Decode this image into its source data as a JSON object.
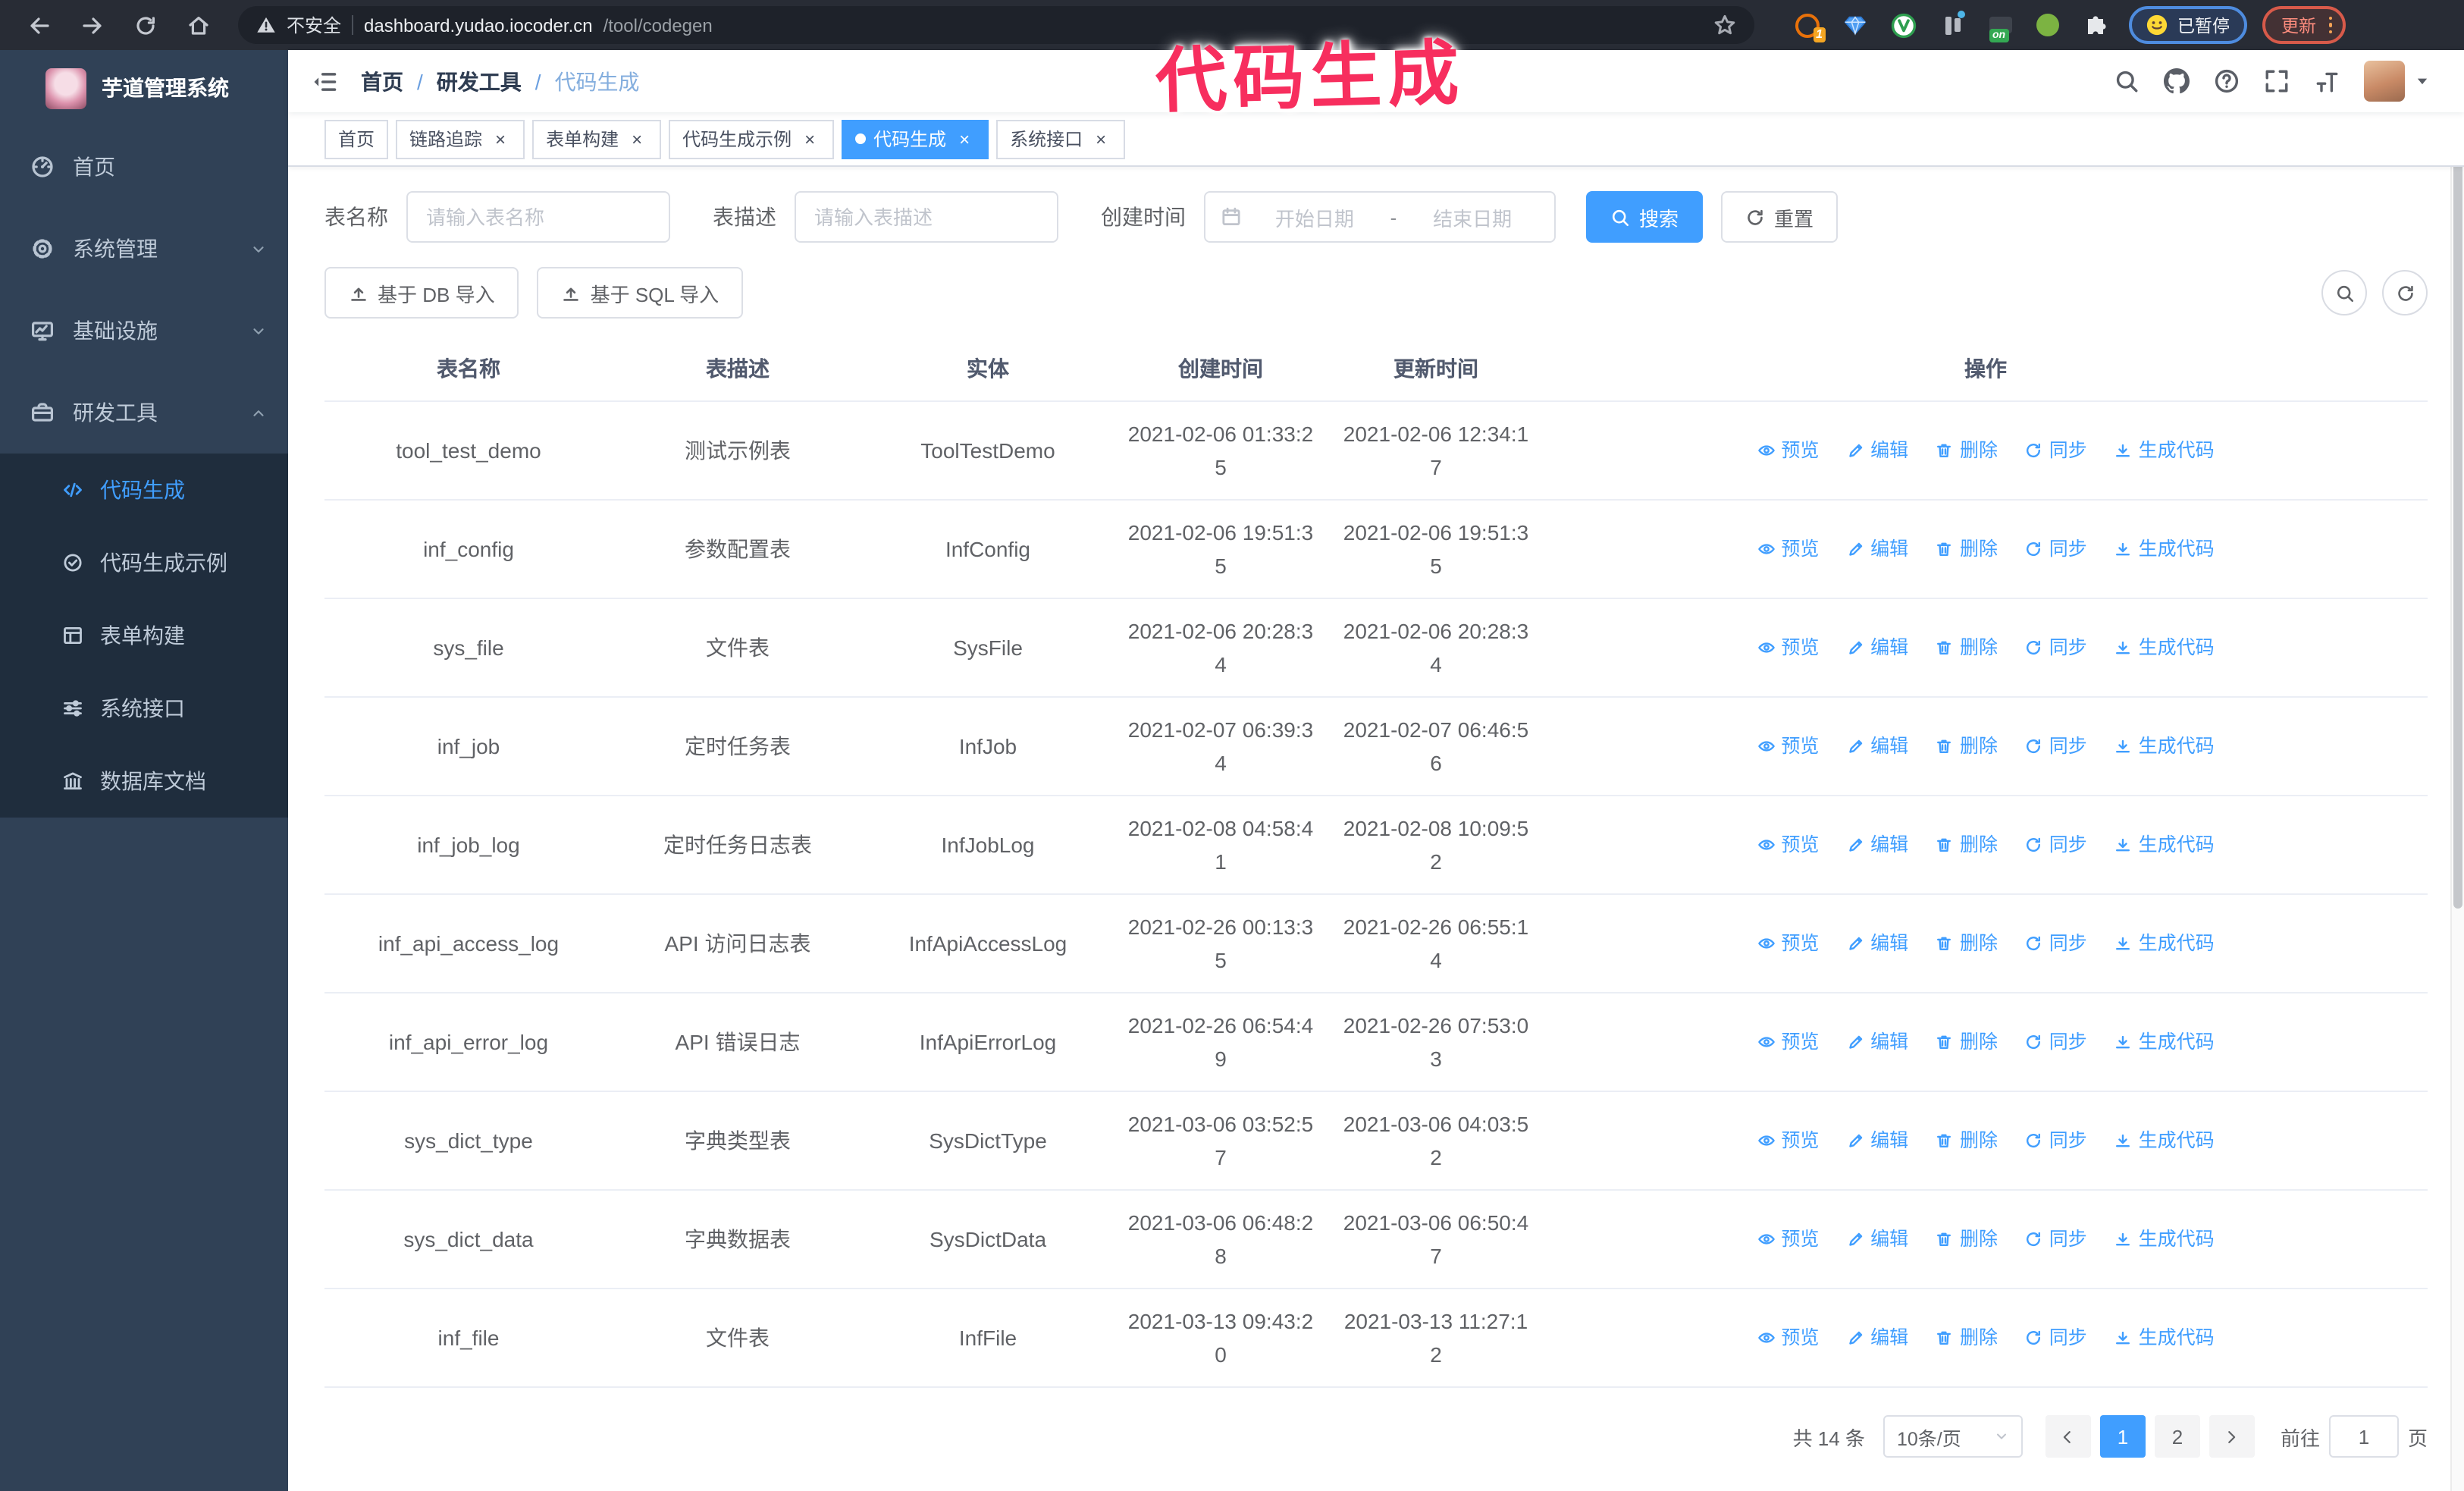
{
  "browser": {
    "security_label": "不安全",
    "url_domain": "dashboard.yudao.iocoder.cn",
    "url_path": "/tool/codegen",
    "extension_badge": "1",
    "extension_on": "on",
    "paused_label": "已暂停",
    "update_label": "更新"
  },
  "annotation": {
    "text": "代码生成",
    "color": "#F72E5E"
  },
  "sidebar": {
    "title": "芋道管理系统",
    "menu": [
      {
        "label": "首页",
        "icon": "dashboard"
      },
      {
        "label": "系统管理",
        "icon": "gear",
        "expandable": true
      },
      {
        "label": "基础设施",
        "icon": "monitor",
        "expandable": true
      },
      {
        "label": "研发工具",
        "icon": "toolbox",
        "expandable": true,
        "expanded": true
      }
    ],
    "submenu": [
      {
        "label": "代码生成",
        "icon": "code",
        "active": true
      },
      {
        "label": "代码生成示例",
        "icon": "badge-check"
      },
      {
        "label": "表单构建",
        "icon": "form"
      },
      {
        "label": "系统接口",
        "icon": "sliders"
      },
      {
        "label": "数据库文档",
        "icon": "database"
      }
    ]
  },
  "navbar": {
    "breadcrumb": [
      "首页",
      "研发工具",
      "代码生成"
    ],
    "separator": "/"
  },
  "tags": [
    {
      "label": "首页"
    },
    {
      "label": "链路追踪",
      "close": "×"
    },
    {
      "label": "表单构建",
      "close": "×"
    },
    {
      "label": "代码生成示例",
      "close": "×"
    },
    {
      "label": "代码生成",
      "close": "×",
      "active": true
    },
    {
      "label": "系统接口",
      "close": "×"
    }
  ],
  "filters": {
    "table_name_label": "表名称",
    "table_name_placeholder": "请输入表名称",
    "table_desc_label": "表描述",
    "table_desc_placeholder": "请输入表描述",
    "create_time_label": "创建时间",
    "date_start_placeholder": "开始日期",
    "date_separator": "-",
    "date_end_placeholder": "结束日期",
    "search_label": "搜索",
    "reset_label": "重置"
  },
  "toolbar": {
    "import_db_label": "基于 DB 导入",
    "import_sql_label": "基于 SQL 导入"
  },
  "table": {
    "columns": [
      "表名称",
      "表描述",
      "实体",
      "创建时间",
      "更新时间",
      "操作"
    ],
    "actions": [
      "预览",
      "编辑",
      "删除",
      "同步",
      "生成代码"
    ],
    "rows": [
      {
        "name": "tool_test_demo",
        "desc": "测试示例表",
        "entity": "ToolTestDemo",
        "created": "2021-02-06 01:33:25",
        "updated": "2021-02-06 12:34:17"
      },
      {
        "name": "inf_config",
        "desc": "参数配置表",
        "entity": "InfConfig",
        "created": "2021-02-06 19:51:35",
        "updated": "2021-02-06 19:51:35"
      },
      {
        "name": "sys_file",
        "desc": "文件表",
        "entity": "SysFile",
        "created": "2021-02-06 20:28:34",
        "updated": "2021-02-06 20:28:34"
      },
      {
        "name": "inf_job",
        "desc": "定时任务表",
        "entity": "InfJob",
        "created": "2021-02-07 06:39:34",
        "updated": "2021-02-07 06:46:56"
      },
      {
        "name": "inf_job_log",
        "desc": "定时任务日志表",
        "entity": "InfJobLog",
        "created": "2021-02-08 04:58:41",
        "updated": "2021-02-08 10:09:52"
      },
      {
        "name": "inf_api_access_log",
        "desc": "API 访问日志表",
        "entity": "InfApiAccessLog",
        "created": "2021-02-26 00:13:35",
        "updated": "2021-02-26 06:55:14"
      },
      {
        "name": "inf_api_error_log",
        "desc": "API 错误日志",
        "entity": "InfApiErrorLog",
        "created": "2021-02-26 06:54:49",
        "updated": "2021-02-26 07:53:03"
      },
      {
        "name": "sys_dict_type",
        "desc": "字典类型表",
        "entity": "SysDictType",
        "created": "2021-03-06 03:52:57",
        "updated": "2021-03-06 04:03:52"
      },
      {
        "name": "sys_dict_data",
        "desc": "字典数据表",
        "entity": "SysDictData",
        "created": "2021-03-06 06:48:28",
        "updated": "2021-03-06 06:50:47"
      },
      {
        "name": "inf_file",
        "desc": "文件表",
        "entity": "InfFile",
        "created": "2021-03-13 09:43:20",
        "updated": "2021-03-13 11:27:12"
      }
    ]
  },
  "pagination": {
    "total_label": "共 14 条",
    "page_size": "10条/页",
    "pages": [
      "1",
      "2"
    ],
    "active_page": "1",
    "goto_label": "前往",
    "goto_value": "1",
    "page_label": "页"
  },
  "colors": {
    "accent": "#409EFF",
    "sidebar_bg": "#304156",
    "submenu_bg": "#1F2D3D",
    "browser_bar": "#282C35",
    "annotation_pink": "#F72E5E",
    "pagination_active": "#409EFF"
  }
}
